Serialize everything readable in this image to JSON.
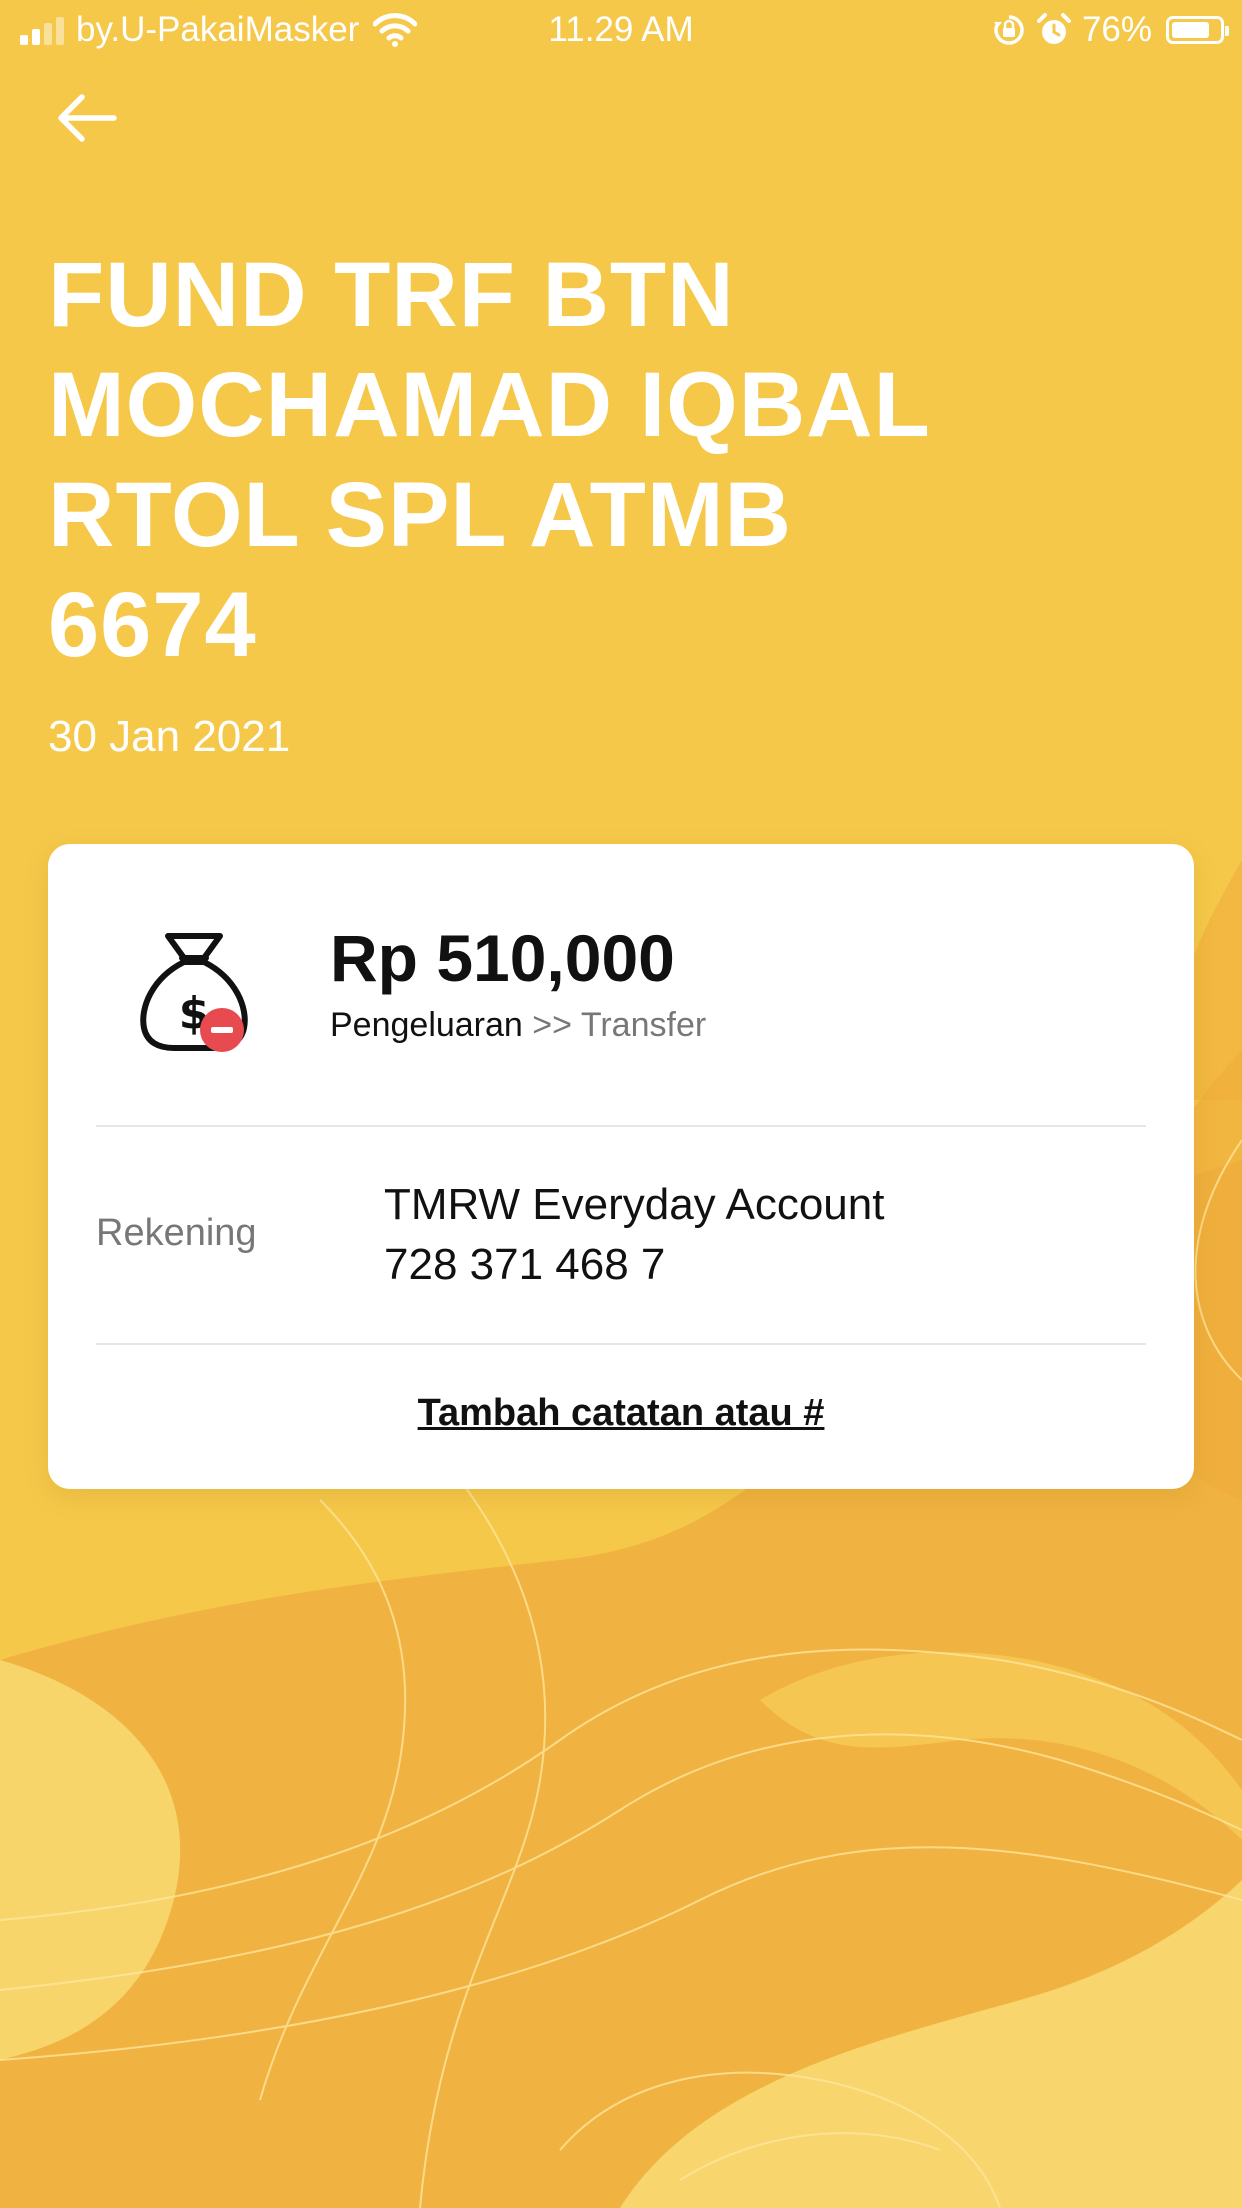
{
  "status_bar": {
    "carrier": "by.U-PakaiMasker",
    "time": "11.29 AM",
    "battery": "76%",
    "icons": [
      "signal-icon",
      "wifi-icon",
      "rotation-lock-icon",
      "alarm-icon",
      "battery-icon"
    ]
  },
  "header": {
    "back_icon": "arrow-left-icon",
    "title_lines": [
      "FUND TRF BTN",
      "MOCHAMAD IQBAL",
      "RTOL SPL ATMB",
      "6674"
    ],
    "date": "30 Jan 2021"
  },
  "card": {
    "icon": "money-bag-minus-icon",
    "amount": "Rp 510,000",
    "category": "Pengeluaran",
    "separator": ">>",
    "subcategory": "Transfer",
    "account_label": "Rekening",
    "account_name": "TMRW Everyday Account",
    "account_number": "728 371 468 7",
    "add_note_label": "Tambah catatan atau #"
  },
  "colors": {
    "background": "#F5C84A",
    "wave_dark": "#F0AF3E",
    "wave_light": "#F8DA72",
    "minus_badge": "#E84B4F",
    "text_primary": "#111111",
    "text_secondary": "#777777"
  }
}
